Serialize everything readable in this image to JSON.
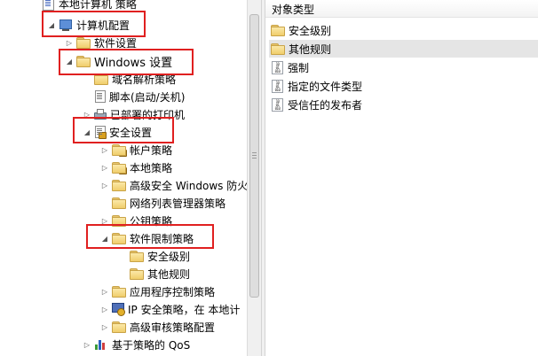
{
  "tree": {
    "root": "本地计算机 策略",
    "computer_config": "计算机配置",
    "software_settings": "软件设置",
    "windows_settings": "Windows 设置",
    "name_resolution": "域名解析策略",
    "scripts": "脚本(启动/关机)",
    "deployed_printers": "已部署的打印机",
    "security_settings": "安全设置",
    "account_policies": "帐户策略",
    "local_policies": "本地策略",
    "advanced_firewall": "高级安全 Windows 防火",
    "network_list": "网络列表管理器策略",
    "public_key": "公钥策略",
    "software_restriction": "软件限制策略",
    "security_levels": "安全级别",
    "additional_rules": "其他规则",
    "app_control": "应用程序控制策略",
    "ip_security": "IP 安全策略，在 本地计",
    "advanced_audit": "高级审核策略配置",
    "qos": "基于策略的 QoS"
  },
  "list": {
    "header": "对象类型",
    "items": [
      {
        "label": "安全级别",
        "icon": "folder-icon"
      },
      {
        "label": "其他规则",
        "icon": "folder-icon",
        "selected": true
      },
      {
        "label": "强制",
        "icon": "binary-file-icon"
      },
      {
        "label": "指定的文件类型",
        "icon": "binary-file-icon"
      },
      {
        "label": "受信任的发布者",
        "icon": "binary-file-icon"
      }
    ]
  },
  "colors": {
    "highlight_box": "#e02020",
    "folder": "#f0cd6b",
    "selection": "#e5e5e5"
  }
}
